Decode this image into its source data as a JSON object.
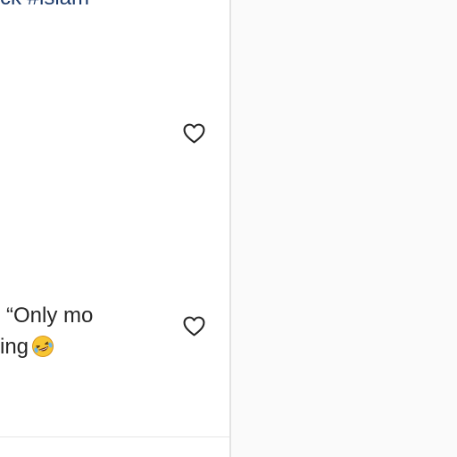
{
  "feed": {
    "hashtag_fragment": "ck #islam",
    "comment": {
      "line1": "“Only mo",
      "line2": "ing"
    }
  },
  "icons": {
    "like": "heart-outline-icon",
    "emoji": "rolling-on-the-floor-laughing-emoji"
  },
  "colors": {
    "hashtag": "#1d3b6b",
    "text": "#262626",
    "right_panel_bg": "#fafafa",
    "divider": "#e3e3e3"
  }
}
